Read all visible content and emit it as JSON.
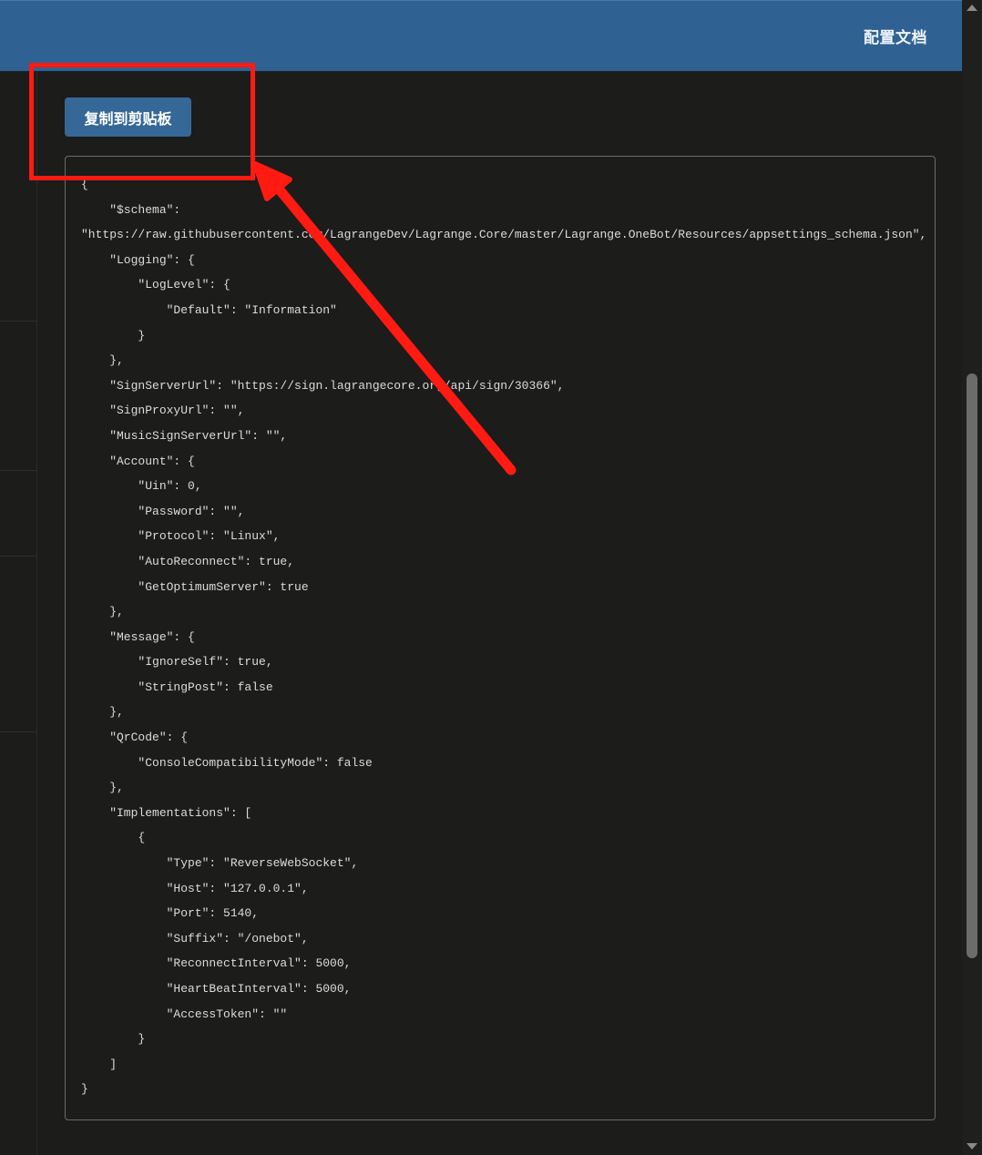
{
  "header": {
    "link_label": "配置文档"
  },
  "toolbar": {
    "copy_label": "复制到剪贴板"
  },
  "config_code": "{\n    \"$schema\":\n\"https://raw.githubusercontent.com/LagrangeDev/Lagrange.Core/master/Lagrange.OneBot/Resources/appsettings_schema.json\",\n    \"Logging\": {\n        \"LogLevel\": {\n            \"Default\": \"Information\"\n        }\n    },\n    \"SignServerUrl\": \"https://sign.lagrangecore.org/api/sign/30366\",\n    \"SignProxyUrl\": \"\",\n    \"MusicSignServerUrl\": \"\",\n    \"Account\": {\n        \"Uin\": 0,\n        \"Password\": \"\",\n        \"Protocol\": \"Linux\",\n        \"AutoReconnect\": true,\n        \"GetOptimumServer\": true\n    },\n    \"Message\": {\n        \"IgnoreSelf\": true,\n        \"StringPost\": false\n    },\n    \"QrCode\": {\n        \"ConsoleCompatibilityMode\": false\n    },\n    \"Implementations\": [\n        {\n            \"Type\": \"ReverseWebSocket\",\n            \"Host\": \"127.0.0.1\",\n            \"Port\": 5140,\n            \"Suffix\": \"/onebot\",\n            \"ReconnectInterval\": 5000,\n            \"HeartBeatInterval\": 5000,\n            \"AccessToken\": \"\"\n        }\n    ]\n}",
  "colors": {
    "header_bg": "#2f6293",
    "button_bg": "#356897",
    "page_bg": "#1c1c1b",
    "annotation_red": "#ff1a12"
  },
  "icons": {
    "scroll_up": "scroll-up-arrow-icon",
    "scroll_down": "scroll-down-arrow-icon",
    "annotation": "red-arrow-icon"
  }
}
